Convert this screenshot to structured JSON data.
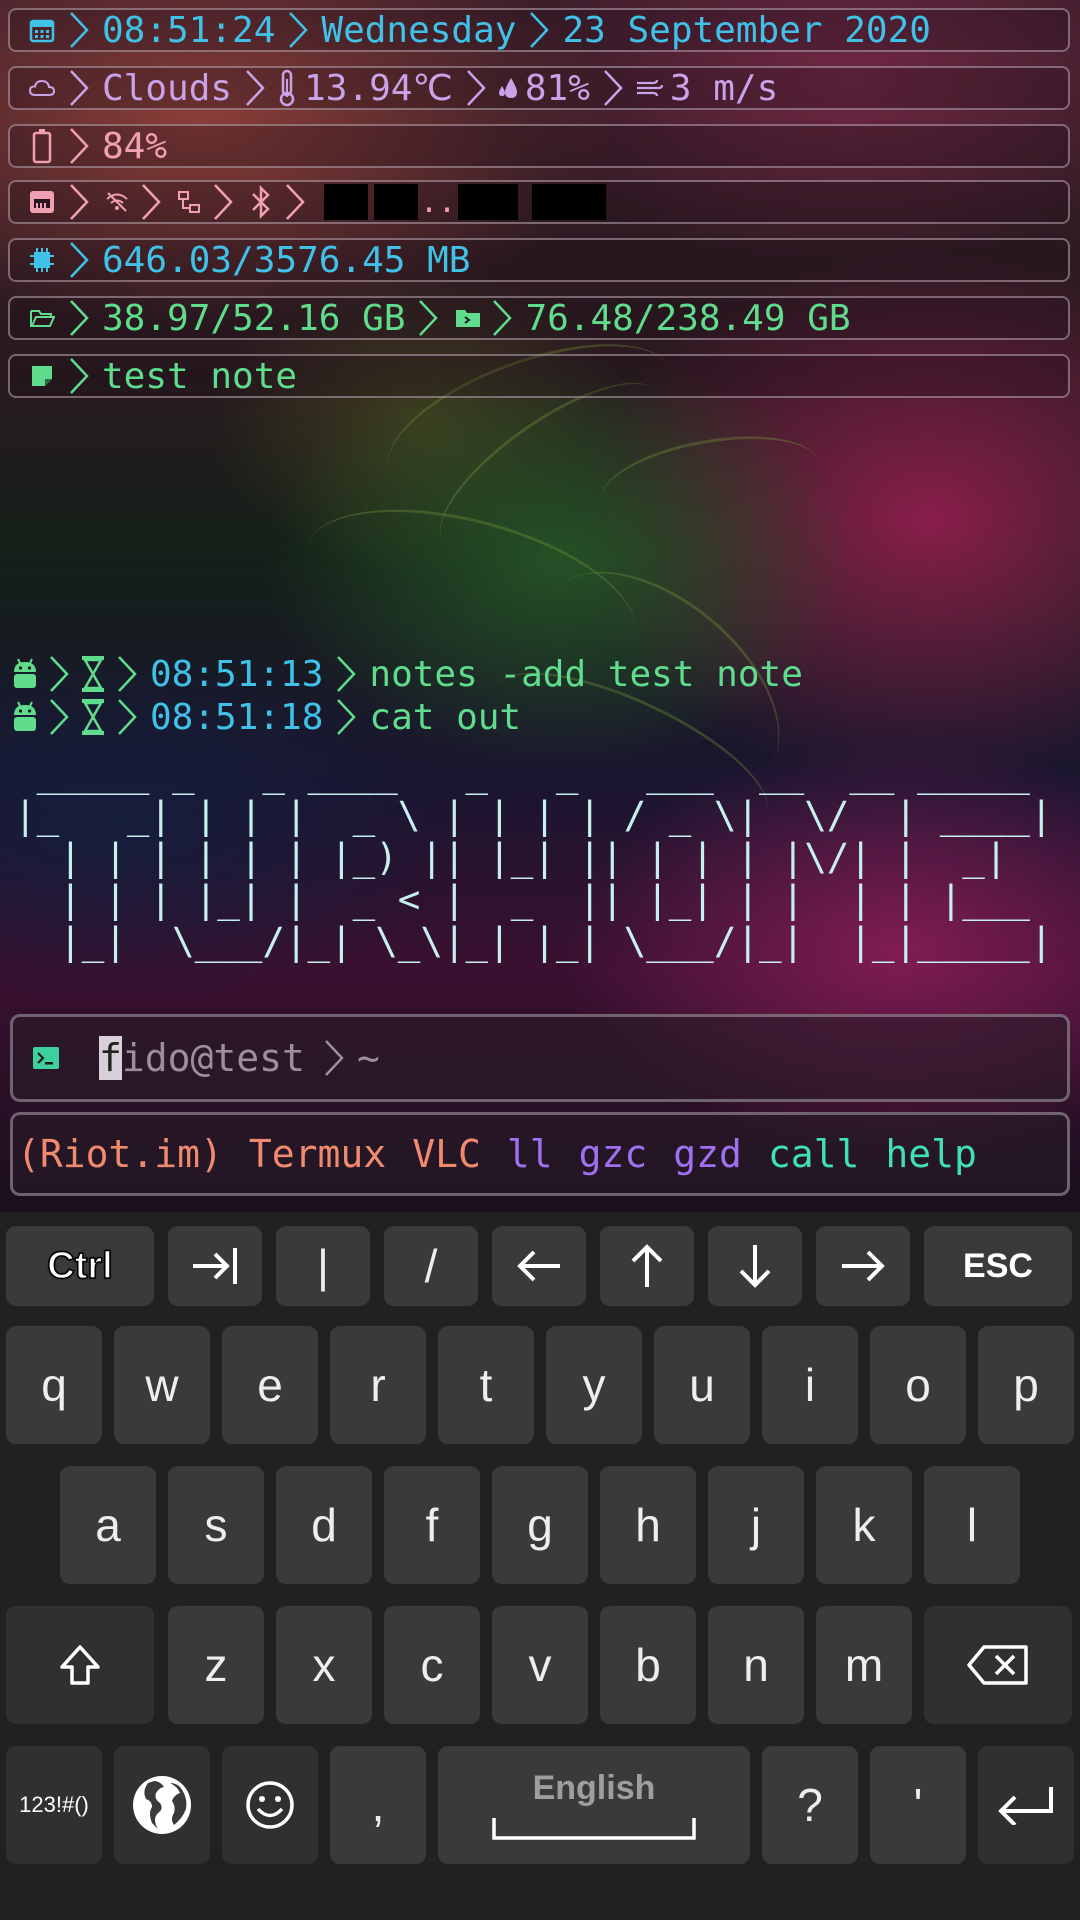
{
  "status": {
    "datetime": {
      "time": "08:51:24",
      "weekday": "Wednesday",
      "date": "23 September 2020"
    },
    "weather": {
      "condition": "Clouds",
      "temperature": "13.94℃",
      "humidity": "81%",
      "wind": "3 m/s"
    },
    "battery": {
      "level": "84%"
    },
    "network": {
      "ip_dots": ".."
    },
    "memory": {
      "usage": "646.03/3576.45 MB"
    },
    "storage": {
      "internal": "38.97/52.16 GB",
      "external": "76.48/238.49 GB"
    },
    "note": {
      "text": "test note"
    }
  },
  "history": [
    {
      "time": "08:51:13",
      "command": "notes -add test note"
    },
    {
      "time": "08:51:18",
      "command": "cat out"
    }
  ],
  "ascii_art": " _____ _   _ ____   _   _   ___  __  __ _____ \n|_   _| | | |  _ \\ | | | | / _ \\|  \\/  | ____|\n  | | | | | | |_) || |_| || | | | |\\/| |  _|  \n  | | | |_| |  _ < |  _  || |_| | |  | | |___ \n  |_|  \\___/|_| \\_\\|_| |_| \\___/|_|  |_|_____|",
  "prompt": {
    "cursor_char": "f",
    "text": "ido@test",
    "path": "~"
  },
  "shortcuts": [
    {
      "label": "(Riot.im)",
      "color": "#f08a6e"
    },
    {
      "label": "Termux",
      "color": "#f08a6e"
    },
    {
      "label": "VLC",
      "color": "#f08a6e"
    },
    {
      "label": "ll",
      "color": "#a070f0"
    },
    {
      "label": "gzc",
      "color": "#a070f0"
    },
    {
      "label": "gzd",
      "color": "#a070f0"
    },
    {
      "label": "call",
      "color": "#3ee0b4"
    },
    {
      "label": "help",
      "color": "#3ee0b4"
    }
  ],
  "keyboard": {
    "extra_row": {
      "ctrl": "Ctrl",
      "pipe": "|",
      "slash": "/",
      "esc": "ESC"
    },
    "row1": [
      "q",
      "w",
      "e",
      "r",
      "t",
      "y",
      "u",
      "i",
      "o",
      "p"
    ],
    "row2": [
      "a",
      "s",
      "d",
      "f",
      "g",
      "h",
      "j",
      "k",
      "l"
    ],
    "row3": [
      "z",
      "x",
      "c",
      "v",
      "b",
      "n",
      "m"
    ],
    "symbols_label": "123!#()",
    "comma": ",",
    "space_label": "English",
    "question": "?",
    "apostrophe": "'"
  },
  "colors": {
    "cyan": "#3fc1e8",
    "violet": "#c9a2e8",
    "pink": "#f0a0b2",
    "green": "#5fdc8c",
    "keyboard_bg": "#212121",
    "key_bg": "#3a3a3a"
  }
}
